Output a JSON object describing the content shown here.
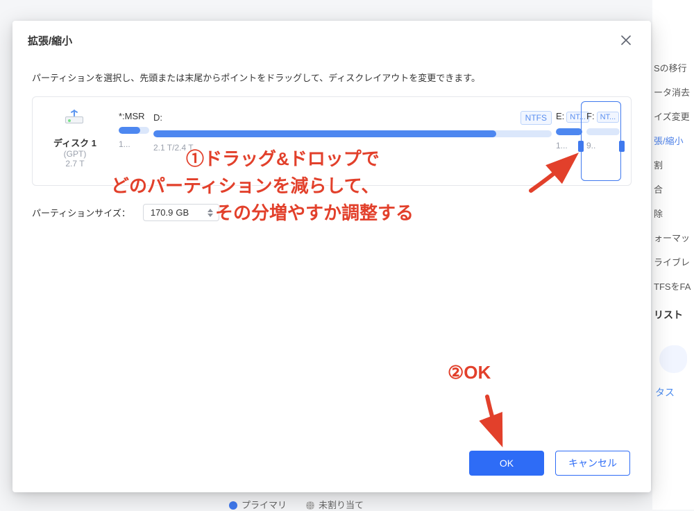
{
  "backdrop": {
    "items": [
      "Sの移行",
      "ータ消去",
      "イズ変更",
      "張/縮小",
      "割",
      "合",
      "除",
      "ォーマッ",
      "ライブレ",
      "TFSをFA"
    ],
    "highlight_index": 3,
    "list_title": "リスト",
    "task": "タス"
  },
  "dialog": {
    "title": "拡張/縮小",
    "instruction": "パーティションを選択し、先頭または末尾からポイントをドラッグして、ディスクレイアウトを変更できます。",
    "disk": {
      "name": "ディスク 1",
      "type": "(GPT)",
      "size": "2.7 T"
    },
    "partitions": {
      "msr": {
        "label": "*:MSR",
        "val": "1...",
        "fill": 70
      },
      "d": {
        "label": "D:",
        "fs": "NTFS",
        "val": "2.1 T/2.4 T",
        "fill": 86
      },
      "e": {
        "label": "E:",
        "fs": "NT...",
        "val": "1...",
        "fill": 100
      },
      "f": {
        "label": "F:",
        "fs": "NT...",
        "val": "9..",
        "fill": 0
      }
    },
    "size_label": "パーティションサイズ：",
    "size_value": "170.9",
    "size_unit": "GB",
    "ok": "OK",
    "cancel": "キャンセル"
  },
  "annotations": {
    "l1": "①ドラッグ&ドロップで",
    "l2": "どのパーティションを減らして、",
    "l3": "その分増やすか調整する",
    "l4": "②OK"
  },
  "legend": {
    "primary": "プライマリ",
    "unallocated": "未割り当て"
  }
}
